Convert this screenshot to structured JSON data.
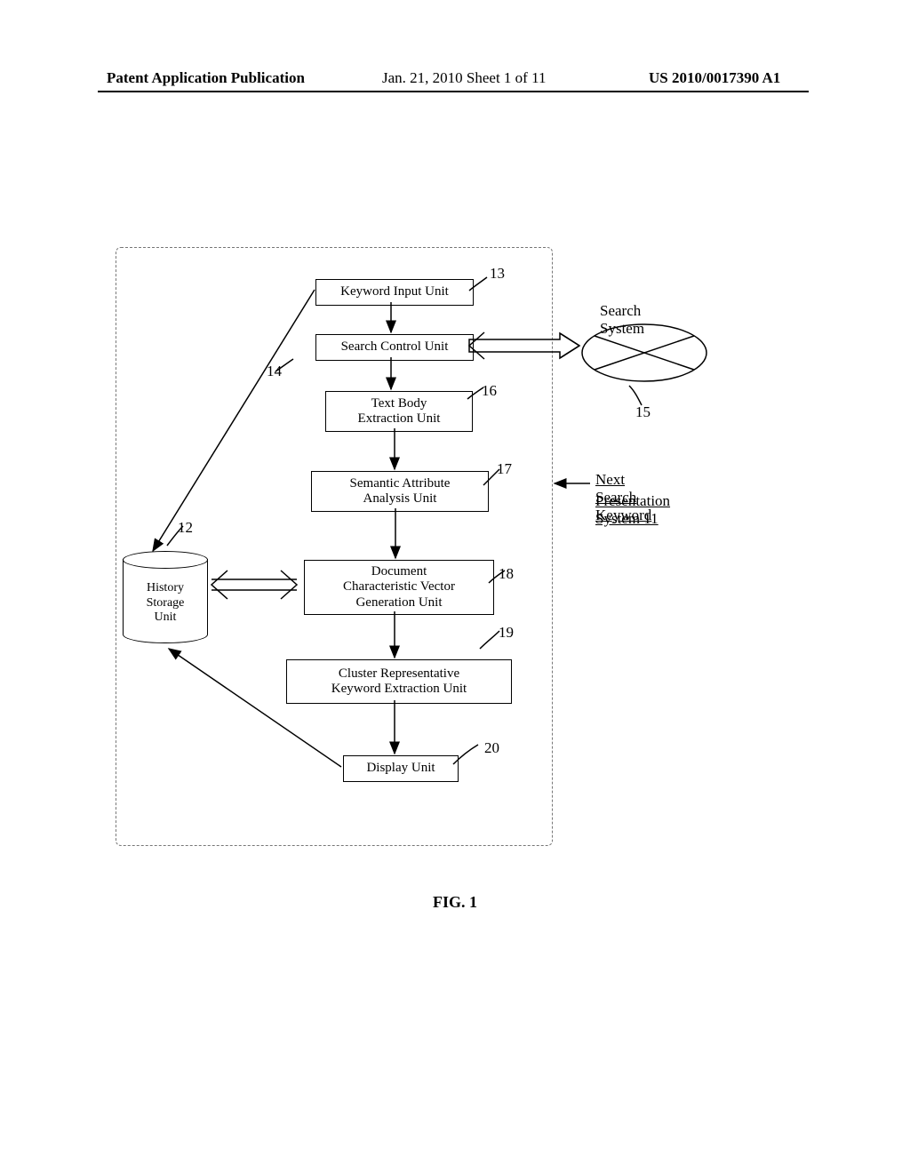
{
  "header": {
    "left": "Patent Application Publication",
    "mid": "Jan. 21, 2010  Sheet 1 of 11",
    "right": "US 2010/0017390 A1"
  },
  "figure_caption": "FIG. 1",
  "labels": {
    "search_system": "Search System",
    "system_title_l1": "Next Search Keyword",
    "system_title_l2": "Presentation System 11",
    "n12": "12",
    "n13": "13",
    "n14": "14",
    "n15": "15",
    "n16": "16",
    "n17": "17",
    "n18": "18",
    "n19": "19",
    "n20": "20"
  },
  "boxes": {
    "keyword_input": "Keyword Input Unit",
    "search_control": "Search Control Unit",
    "text_body_l1": "Text Body",
    "text_body_l2": "Extraction Unit",
    "semantic_l1": "Semantic Attribute",
    "semantic_l2": "Analysis Unit",
    "docvec_l1": "Document",
    "docvec_l2": "Characteristic Vector",
    "docvec_l3": "Generation Unit",
    "cluster_l1": "Cluster Representative",
    "cluster_l2": "Keyword Extraction Unit",
    "display": "Display Unit",
    "history_l1": "History",
    "history_l2": "Storage",
    "history_l3": "Unit"
  }
}
